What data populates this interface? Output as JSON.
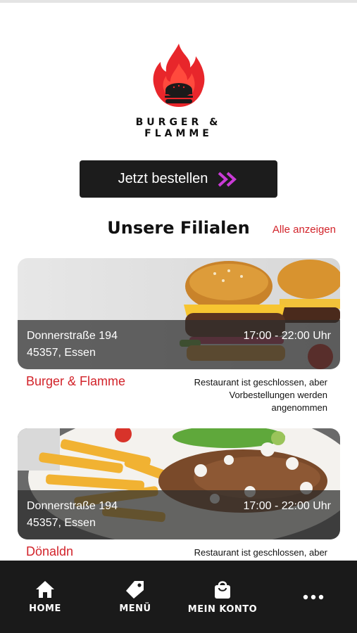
{
  "brand": {
    "name": "BURGER & FLAMME"
  },
  "order_button": {
    "label": "Jetzt bestellen"
  },
  "branches_section": {
    "title": "Unsere Filialen",
    "see_all": "Alle anzeigen"
  },
  "branches": [
    {
      "address_line1": "Donnerstraße 194",
      "address_line2": "45357, Essen",
      "hours": "17:00 - 22:00 Uhr",
      "name": "Burger & Flamme",
      "status": "Restaurant ist geschlossen, aber Vorbestellungen werden angenommen",
      "image_icon": "burger-photo"
    },
    {
      "address_line1": "Donnerstraße 194",
      "address_line2": "45357, Essen",
      "hours": "17:00 - 22:00 Uhr",
      "name": "Dönaldn",
      "status": "Restaurant ist geschlossen, aber",
      "image_icon": "doner-plate-photo"
    }
  ],
  "nav": [
    {
      "label": "HOME",
      "icon": "home-icon"
    },
    {
      "label": "MENÜ",
      "icon": "tag-icon"
    },
    {
      "label": "MEIN KONTO",
      "icon": "shopping-bag-icon"
    },
    {
      "label": "",
      "icon": "more-icon"
    }
  ],
  "colors": {
    "accent_red": "#d2232a",
    "button_bg": "#1c1c1c",
    "nav_bg": "#1a1a1a",
    "chevron_pink": "#c93bd6"
  }
}
